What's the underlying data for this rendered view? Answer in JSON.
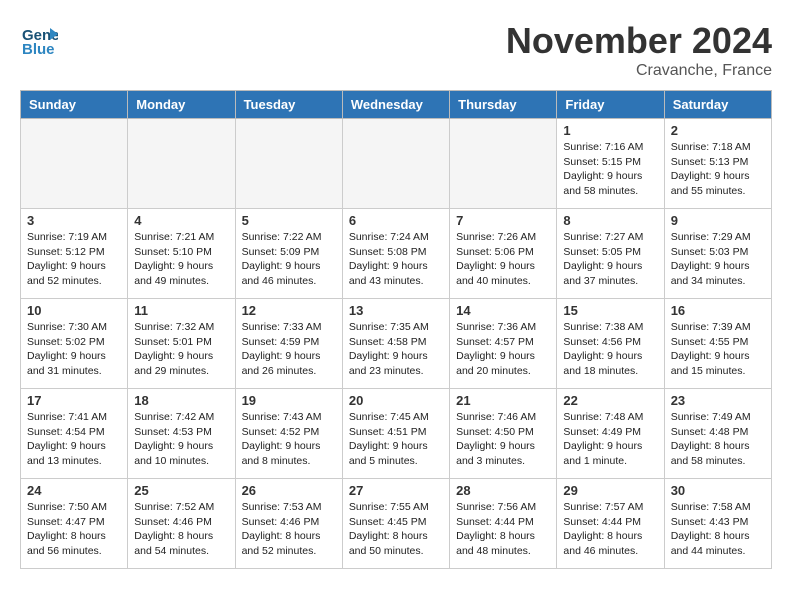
{
  "header": {
    "logo_line1": "General",
    "logo_line2": "Blue",
    "month_title": "November 2024",
    "location": "Cravanche, France"
  },
  "weekdays": [
    "Sunday",
    "Monday",
    "Tuesday",
    "Wednesday",
    "Thursday",
    "Friday",
    "Saturday"
  ],
  "weeks": [
    [
      {
        "day": "",
        "empty": true
      },
      {
        "day": "",
        "empty": true
      },
      {
        "day": "",
        "empty": true
      },
      {
        "day": "",
        "empty": true
      },
      {
        "day": "",
        "empty": true
      },
      {
        "day": "1",
        "info": "Sunrise: 7:16 AM\nSunset: 5:15 PM\nDaylight: 9 hours and 58 minutes."
      },
      {
        "day": "2",
        "info": "Sunrise: 7:18 AM\nSunset: 5:13 PM\nDaylight: 9 hours and 55 minutes."
      }
    ],
    [
      {
        "day": "3",
        "info": "Sunrise: 7:19 AM\nSunset: 5:12 PM\nDaylight: 9 hours and 52 minutes."
      },
      {
        "day": "4",
        "info": "Sunrise: 7:21 AM\nSunset: 5:10 PM\nDaylight: 9 hours and 49 minutes."
      },
      {
        "day": "5",
        "info": "Sunrise: 7:22 AM\nSunset: 5:09 PM\nDaylight: 9 hours and 46 minutes."
      },
      {
        "day": "6",
        "info": "Sunrise: 7:24 AM\nSunset: 5:08 PM\nDaylight: 9 hours and 43 minutes."
      },
      {
        "day": "7",
        "info": "Sunrise: 7:26 AM\nSunset: 5:06 PM\nDaylight: 9 hours and 40 minutes."
      },
      {
        "day": "8",
        "info": "Sunrise: 7:27 AM\nSunset: 5:05 PM\nDaylight: 9 hours and 37 minutes."
      },
      {
        "day": "9",
        "info": "Sunrise: 7:29 AM\nSunset: 5:03 PM\nDaylight: 9 hours and 34 minutes."
      }
    ],
    [
      {
        "day": "10",
        "info": "Sunrise: 7:30 AM\nSunset: 5:02 PM\nDaylight: 9 hours and 31 minutes."
      },
      {
        "day": "11",
        "info": "Sunrise: 7:32 AM\nSunset: 5:01 PM\nDaylight: 9 hours and 29 minutes."
      },
      {
        "day": "12",
        "info": "Sunrise: 7:33 AM\nSunset: 4:59 PM\nDaylight: 9 hours and 26 minutes."
      },
      {
        "day": "13",
        "info": "Sunrise: 7:35 AM\nSunset: 4:58 PM\nDaylight: 9 hours and 23 minutes."
      },
      {
        "day": "14",
        "info": "Sunrise: 7:36 AM\nSunset: 4:57 PM\nDaylight: 9 hours and 20 minutes."
      },
      {
        "day": "15",
        "info": "Sunrise: 7:38 AM\nSunset: 4:56 PM\nDaylight: 9 hours and 18 minutes."
      },
      {
        "day": "16",
        "info": "Sunrise: 7:39 AM\nSunset: 4:55 PM\nDaylight: 9 hours and 15 minutes."
      }
    ],
    [
      {
        "day": "17",
        "info": "Sunrise: 7:41 AM\nSunset: 4:54 PM\nDaylight: 9 hours and 13 minutes."
      },
      {
        "day": "18",
        "info": "Sunrise: 7:42 AM\nSunset: 4:53 PM\nDaylight: 9 hours and 10 minutes."
      },
      {
        "day": "19",
        "info": "Sunrise: 7:43 AM\nSunset: 4:52 PM\nDaylight: 9 hours and 8 minutes."
      },
      {
        "day": "20",
        "info": "Sunrise: 7:45 AM\nSunset: 4:51 PM\nDaylight: 9 hours and 5 minutes."
      },
      {
        "day": "21",
        "info": "Sunrise: 7:46 AM\nSunset: 4:50 PM\nDaylight: 9 hours and 3 minutes."
      },
      {
        "day": "22",
        "info": "Sunrise: 7:48 AM\nSunset: 4:49 PM\nDaylight: 9 hours and 1 minute."
      },
      {
        "day": "23",
        "info": "Sunrise: 7:49 AM\nSunset: 4:48 PM\nDaylight: 8 hours and 58 minutes."
      }
    ],
    [
      {
        "day": "24",
        "info": "Sunrise: 7:50 AM\nSunset: 4:47 PM\nDaylight: 8 hours and 56 minutes."
      },
      {
        "day": "25",
        "info": "Sunrise: 7:52 AM\nSunset: 4:46 PM\nDaylight: 8 hours and 54 minutes."
      },
      {
        "day": "26",
        "info": "Sunrise: 7:53 AM\nSunset: 4:46 PM\nDaylight: 8 hours and 52 minutes."
      },
      {
        "day": "27",
        "info": "Sunrise: 7:55 AM\nSunset: 4:45 PM\nDaylight: 8 hours and 50 minutes."
      },
      {
        "day": "28",
        "info": "Sunrise: 7:56 AM\nSunset: 4:44 PM\nDaylight: 8 hours and 48 minutes."
      },
      {
        "day": "29",
        "info": "Sunrise: 7:57 AM\nSunset: 4:44 PM\nDaylight: 8 hours and 46 minutes."
      },
      {
        "day": "30",
        "info": "Sunrise: 7:58 AM\nSunset: 4:43 PM\nDaylight: 8 hours and 44 minutes."
      }
    ]
  ]
}
